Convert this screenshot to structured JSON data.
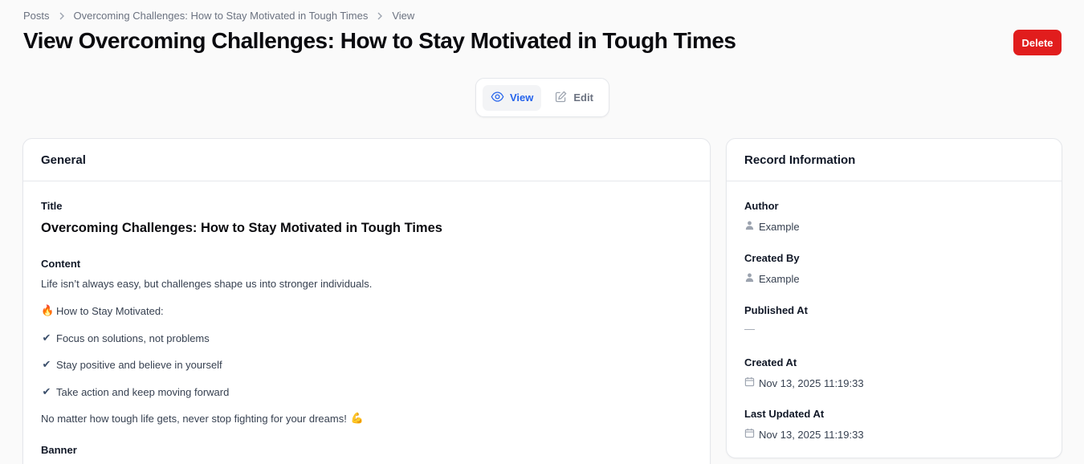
{
  "breadcrumb": {
    "items": [
      "Posts",
      "Overcoming Challenges: How to Stay Motivated in Tough Times",
      "View"
    ]
  },
  "header": {
    "title": "View Overcoming Challenges: How to Stay Motivated in Tough Times",
    "delete_label": "Delete"
  },
  "tabs": {
    "view_label": "View",
    "edit_label": "Edit"
  },
  "general": {
    "heading": "General",
    "title_label": "Title",
    "title_value": "Overcoming Challenges: How to Stay Motivated in Tough Times",
    "content_label": "Content",
    "content": {
      "intro": "Life isn’t always easy, but challenges shape us into stronger individuals.",
      "subheading": "How to Stay Motivated:",
      "points": [
        "Focus on solutions, not problems",
        "Stay positive and believe in yourself",
        "Take action and keep moving forward"
      ],
      "closing": "No matter how tough life gets, never stop fighting for your dreams!"
    },
    "banner_label": "Banner"
  },
  "record": {
    "heading": "Record Information",
    "author_label": "Author",
    "author_value": "Example",
    "created_by_label": "Created By",
    "created_by_value": "Example",
    "published_at_label": "Published At",
    "published_at_value": "—",
    "created_at_label": "Created At",
    "created_at_value": "Nov 13, 2025 11:19:33",
    "updated_at_label": "Last Updated At",
    "updated_at_value": "Nov 13, 2025 11:19:33"
  },
  "colors": {
    "accent": "#2563eb",
    "danger": "#e11d1d",
    "background": "#fafafa"
  }
}
